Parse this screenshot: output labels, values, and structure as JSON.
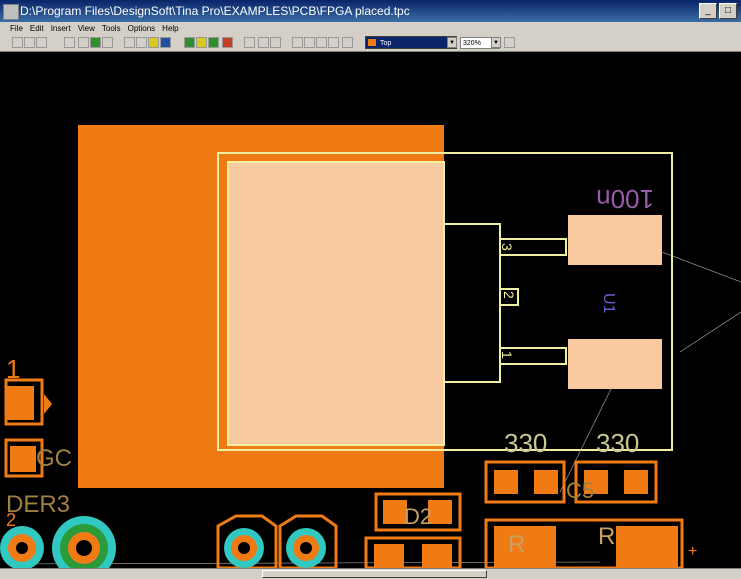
{
  "window": {
    "title": "D:\\Program Files\\DesignSoft\\Tina Pro\\EXAMPLES\\PCB\\FPGA placed.tpc",
    "buttons": [
      "_",
      "□"
    ]
  },
  "menu": [
    "File",
    "Edit",
    "Insert",
    "View",
    "Tools",
    "Options",
    "Help"
  ],
  "toolbar": {
    "layer": "Top",
    "zoom": "320%"
  },
  "pcb": {
    "silkscreen_labels": {
      "cap_value": "100n",
      "r1_value": "330",
      "r2_value": "330",
      "pin3": "3",
      "pin2": "2",
      "pin1": "1",
      "ref_u": "U1",
      "left_1": "1",
      "left_gc": "GC",
      "left_der3": "DER3",
      "left_2": "2",
      "d2": "D2",
      "c5": "C5",
      "r_ref": "R",
      "r_ref2": "R",
      "plus": "+"
    },
    "colors": {
      "background": "#000000",
      "copper": "#f07a14",
      "pad_light": "#f9c9a0",
      "silk": "#f0f0a0",
      "teal": "#30c8c0",
      "green": "#2a9a3a",
      "magenta_text": "#9a5aaa"
    }
  }
}
